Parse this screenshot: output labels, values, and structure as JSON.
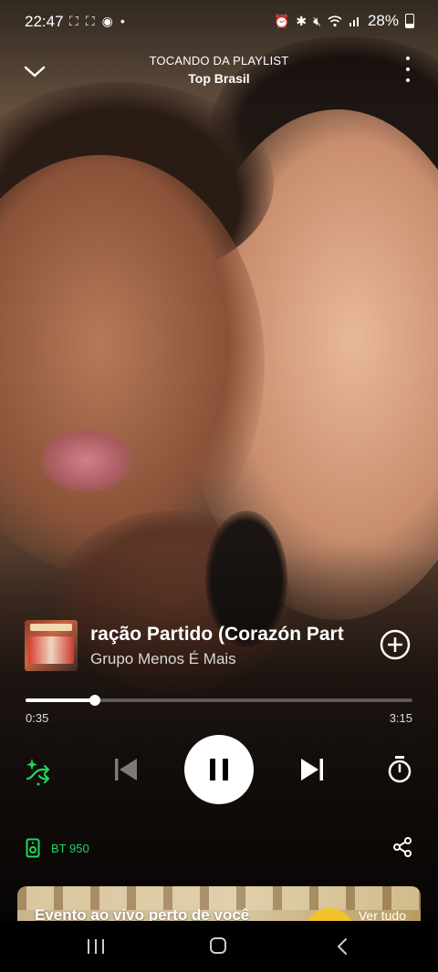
{
  "status_bar": {
    "time": "22:47",
    "battery": "28%"
  },
  "header": {
    "context_label": "TOCANDO DA PLAYLIST",
    "playlist_name": "Top Brasil"
  },
  "track": {
    "title": "ração Partido (Corazón Part",
    "artist": "Grupo Menos É Mais"
  },
  "progress": {
    "elapsed": "0:35",
    "total": "3:15",
    "fraction": 0.18
  },
  "device": {
    "name": "BT 950"
  },
  "card": {
    "title": "Evento ao vivo perto de você",
    "action": "Ver tudo"
  },
  "colors": {
    "accent": "#1ed760",
    "play_button": "#ffffff"
  },
  "icons": {
    "collapse": "chevron-down-icon",
    "more": "more-vert-icon",
    "add": "add-circle-icon",
    "shuffle": "smart-shuffle-icon",
    "previous": "skip-previous-icon",
    "pause": "pause-icon",
    "next": "skip-next-icon",
    "sleep_timer": "timer-icon",
    "device": "speaker-icon",
    "share": "share-icon"
  }
}
